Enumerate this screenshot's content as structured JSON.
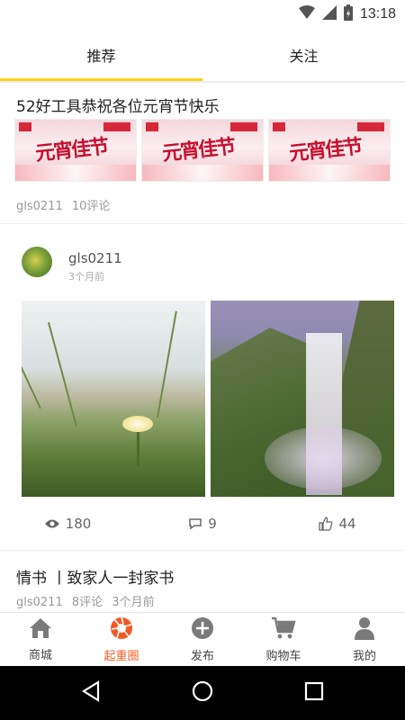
{
  "status_bar": {
    "time": "13:18"
  },
  "top_tabs": [
    {
      "label": "推荐",
      "active": true
    },
    {
      "label": "关注",
      "active": false
    }
  ],
  "feed": {
    "post1": {
      "title": "52好工具恭祝各位元宵节快乐",
      "banner_text": "元宵佳节",
      "author": "gls0211",
      "comments": "10评论"
    },
    "post2": {
      "author": "gls0211",
      "time": "3个月前",
      "views": "180",
      "comments": "9",
      "likes": "44"
    },
    "post3": {
      "title": "情书  丨致家人一封家书",
      "author": "gls0211",
      "comments": "8评论",
      "time": "3个月前"
    }
  },
  "bottom_nav": [
    {
      "label": "商城",
      "icon": "home-icon",
      "active": false
    },
    {
      "label": "起重圈",
      "icon": "camera-shutter-icon",
      "active": true
    },
    {
      "label": "发布",
      "icon": "plus-circle-icon",
      "active": false
    },
    {
      "label": "购物车",
      "icon": "cart-icon",
      "active": false
    },
    {
      "label": "我的",
      "icon": "user-icon",
      "active": false
    }
  ],
  "colors": {
    "accent_tab": "#f5d316",
    "active_nav": "#f15a24",
    "icon_gray": "#7a7a7a"
  }
}
